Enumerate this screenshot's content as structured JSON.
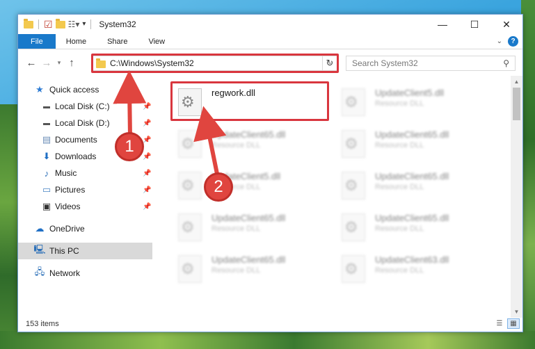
{
  "window": {
    "title": "System32",
    "controls": {
      "minimize": "—",
      "maximize": "☐",
      "close": "✕"
    }
  },
  "ribbon": {
    "tabs": [
      "File",
      "Home",
      "Share",
      "View"
    ],
    "help": "?"
  },
  "address": {
    "path": "C:\\Windows\\System32",
    "search_placeholder": "Search System32"
  },
  "sidebar": {
    "quick_access": "Quick access",
    "pinned": [
      {
        "label": "Local Disk (C:)",
        "icon": "drive-icon"
      },
      {
        "label": "Local Disk (D:)",
        "icon": "drive-icon"
      },
      {
        "label": "Documents",
        "icon": "documents-icon"
      },
      {
        "label": "Downloads",
        "icon": "download-icon"
      },
      {
        "label": "Music",
        "icon": "music-icon"
      },
      {
        "label": "Pictures",
        "icon": "pictures-icon"
      },
      {
        "label": "Videos",
        "icon": "videos-icon"
      }
    ],
    "onedrive": "OneDrive",
    "this_pc": "This PC",
    "network": "Network"
  },
  "files": [
    {
      "name": "regwork.dll",
      "type": ""
    },
    {
      "name": "UpdateClient5.dll",
      "type": "Resource DLL"
    },
    {
      "name": "UpdateClient65.dll",
      "type": "Resource DLL"
    },
    {
      "name": "UpdateClient65.dll",
      "type": "Resource DLL"
    },
    {
      "name": "UpdateClient5.dll",
      "type": "Resource DLL"
    },
    {
      "name": "UpdateClient65.dll",
      "type": "Resource DLL"
    },
    {
      "name": "UpdateClient65.dll",
      "type": "Resource DLL"
    },
    {
      "name": "UpdateClient65.dll",
      "type": "Resource DLL"
    },
    {
      "name": "UpdateClient65.dll",
      "type": "Resource DLL"
    },
    {
      "name": "UpdateClient63.dll",
      "type": "Resource DLL"
    }
  ],
  "status": {
    "item_count": "153 items"
  },
  "annotations": {
    "step1": "1",
    "step2": "2",
    "highlight_color": "#d9363e"
  }
}
